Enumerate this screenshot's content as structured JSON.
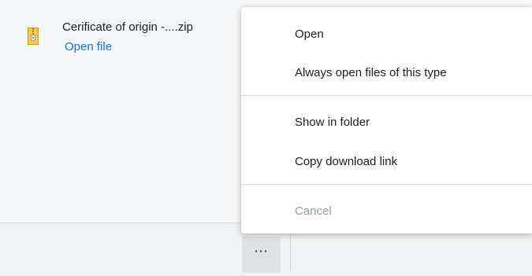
{
  "context_menu": {
    "items": [
      {
        "label": "Open",
        "enabled": true
      },
      {
        "label": "Always open files of this type",
        "enabled": true
      },
      {
        "label": "Show in folder",
        "enabled": true
      },
      {
        "label": "Copy download link",
        "enabled": true
      },
      {
        "label": "Cancel",
        "enabled": false
      }
    ]
  },
  "download_shelf": {
    "item": {
      "file_name": "Cerificate of origin -....zip",
      "action_label": "Open file",
      "icon": "zip-archive-icon"
    },
    "more_button_label": "⋯"
  },
  "colors": {
    "link": "#1a73e8",
    "disabled_text": "#9aa0a6",
    "icon_yellow": "#f2c94c"
  }
}
